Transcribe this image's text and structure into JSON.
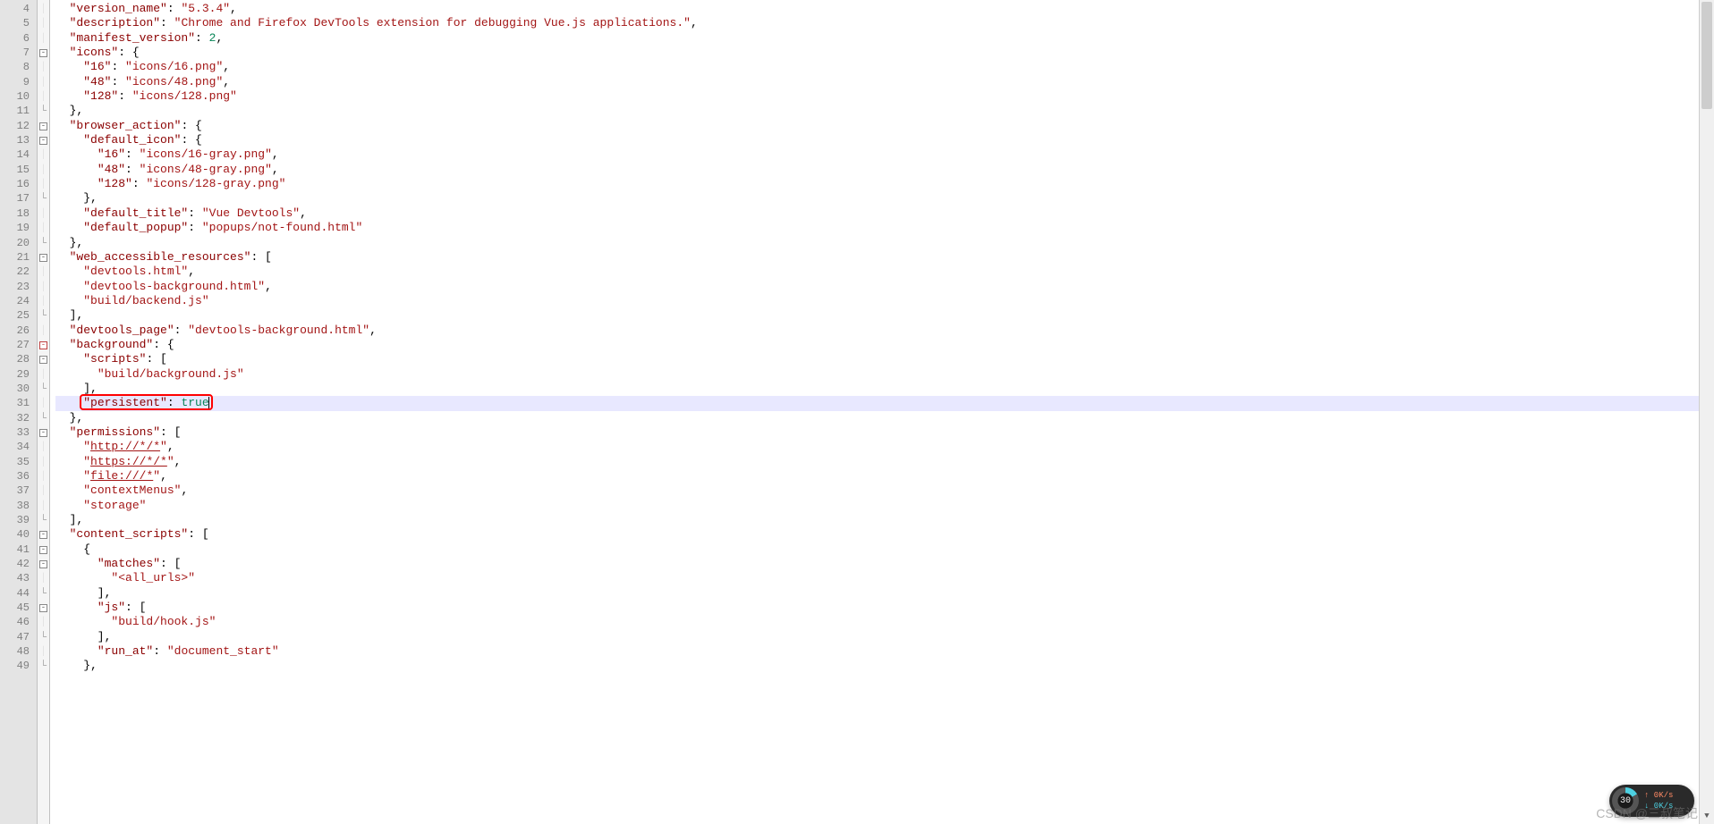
{
  "first_line": 4,
  "highlighted_line": 31,
  "lines": [
    {
      "t": [
        [
          "  ",
          "p"
        ],
        [
          "\"version_name\"",
          "key"
        ],
        [
          ": ",
          "p"
        ],
        [
          "\"5.3.4\"",
          "s"
        ],
        [
          ",",
          "p"
        ]
      ]
    },
    {
      "t": [
        [
          "  ",
          "p"
        ],
        [
          "\"description\"",
          "key"
        ],
        [
          ": ",
          "p"
        ],
        [
          "\"Chrome and Firefox DevTools extension for debugging Vue.js applications.\"",
          "s"
        ],
        [
          ",",
          "p"
        ]
      ]
    },
    {
      "t": [
        [
          "  ",
          "p"
        ],
        [
          "\"manifest_version\"",
          "key"
        ],
        [
          ": ",
          "p"
        ],
        [
          "2",
          "n"
        ],
        [
          ",",
          "p"
        ]
      ]
    },
    {
      "t": [
        [
          "  ",
          "p"
        ],
        [
          "\"icons\"",
          "key"
        ],
        [
          ": {",
          "p"
        ]
      ],
      "fold": "-"
    },
    {
      "t": [
        [
          "    ",
          "p"
        ],
        [
          "\"16\"",
          "key"
        ],
        [
          ": ",
          "p"
        ],
        [
          "\"icons/16.png\"",
          "s"
        ],
        [
          ",",
          "p"
        ]
      ]
    },
    {
      "t": [
        [
          "    ",
          "p"
        ],
        [
          "\"48\"",
          "key"
        ],
        [
          ": ",
          "p"
        ],
        [
          "\"icons/48.png\"",
          "s"
        ],
        [
          ",",
          "p"
        ]
      ]
    },
    {
      "t": [
        [
          "    ",
          "p"
        ],
        [
          "\"128\"",
          "key"
        ],
        [
          ": ",
          "p"
        ],
        [
          "\"icons/128.png\"",
          "s"
        ]
      ]
    },
    {
      "t": [
        [
          "  },",
          "p"
        ]
      ],
      "foldend": true
    },
    {
      "t": [
        [
          "  ",
          "p"
        ],
        [
          "\"browser_action\"",
          "key"
        ],
        [
          ": {",
          "p"
        ]
      ],
      "fold": "-"
    },
    {
      "t": [
        [
          "    ",
          "p"
        ],
        [
          "\"default_icon\"",
          "key"
        ],
        [
          ": {",
          "p"
        ]
      ],
      "fold": "-"
    },
    {
      "t": [
        [
          "      ",
          "p"
        ],
        [
          "\"16\"",
          "key"
        ],
        [
          ": ",
          "p"
        ],
        [
          "\"icons/16-gray.png\"",
          "s"
        ],
        [
          ",",
          "p"
        ]
      ]
    },
    {
      "t": [
        [
          "      ",
          "p"
        ],
        [
          "\"48\"",
          "key"
        ],
        [
          ": ",
          "p"
        ],
        [
          "\"icons/48-gray.png\"",
          "s"
        ],
        [
          ",",
          "p"
        ]
      ]
    },
    {
      "t": [
        [
          "      ",
          "p"
        ],
        [
          "\"128\"",
          "key"
        ],
        [
          ": ",
          "p"
        ],
        [
          "\"icons/128-gray.png\"",
          "s"
        ]
      ]
    },
    {
      "t": [
        [
          "    },",
          "p"
        ]
      ],
      "foldend": true
    },
    {
      "t": [
        [
          "    ",
          "p"
        ],
        [
          "\"default_title\"",
          "key"
        ],
        [
          ": ",
          "p"
        ],
        [
          "\"Vue Devtools\"",
          "s"
        ],
        [
          ",",
          "p"
        ]
      ]
    },
    {
      "t": [
        [
          "    ",
          "p"
        ],
        [
          "\"default_popup\"",
          "key"
        ],
        [
          ": ",
          "p"
        ],
        [
          "\"popups/not-found.html\"",
          "s"
        ]
      ]
    },
    {
      "t": [
        [
          "  },",
          "p"
        ]
      ],
      "foldend": true
    },
    {
      "t": [
        [
          "  ",
          "p"
        ],
        [
          "\"web_accessible_resources\"",
          "key"
        ],
        [
          ": [",
          "p"
        ]
      ],
      "fold": "-"
    },
    {
      "t": [
        [
          "    ",
          "p"
        ],
        [
          "\"devtools.html\"",
          "s"
        ],
        [
          ",",
          "p"
        ]
      ]
    },
    {
      "t": [
        [
          "    ",
          "p"
        ],
        [
          "\"devtools-background.html\"",
          "s"
        ],
        [
          ",",
          "p"
        ]
      ]
    },
    {
      "t": [
        [
          "    ",
          "p"
        ],
        [
          "\"build/backend.js\"",
          "s"
        ]
      ]
    },
    {
      "t": [
        [
          "  ],",
          "p"
        ]
      ],
      "foldend": true
    },
    {
      "t": [
        [
          "  ",
          "p"
        ],
        [
          "\"devtools_page\"",
          "key"
        ],
        [
          ": ",
          "p"
        ],
        [
          "\"devtools-background.html\"",
          "s"
        ],
        [
          ",",
          "p"
        ]
      ]
    },
    {
      "t": [
        [
          "  ",
          "p"
        ],
        [
          "\"background\"",
          "key"
        ],
        [
          ": {",
          "p"
        ]
      ],
      "fold": "-r"
    },
    {
      "t": [
        [
          "    ",
          "p"
        ],
        [
          "\"scripts\"",
          "key"
        ],
        [
          ": [",
          "p"
        ]
      ],
      "fold": "-"
    },
    {
      "t": [
        [
          "      ",
          "p"
        ],
        [
          "\"build/background.js\"",
          "s"
        ]
      ]
    },
    {
      "t": [
        [
          "    ],",
          "p"
        ]
      ],
      "foldend": true
    },
    {
      "t": [
        [
          "    ",
          "p"
        ],
        [
          "\"persistent\"",
          "key"
        ],
        [
          ": ",
          "p"
        ],
        [
          "true",
          "n"
        ]
      ],
      "hl": true,
      "caret": true
    },
    {
      "t": [
        [
          "  },",
          "p"
        ]
      ],
      "foldend": true
    },
    {
      "t": [
        [
          "  ",
          "p"
        ],
        [
          "\"permissions\"",
          "key"
        ],
        [
          ": [",
          "p"
        ]
      ],
      "fold": "-"
    },
    {
      "t": [
        [
          "    ",
          "p"
        ],
        [
          "\"",
          "s"
        ],
        [
          "http://*/*",
          "s u"
        ],
        [
          "\"",
          "s"
        ],
        [
          ",",
          "p"
        ]
      ]
    },
    {
      "t": [
        [
          "    ",
          "p"
        ],
        [
          "\"",
          "s"
        ],
        [
          "https://*/*",
          "s u"
        ],
        [
          "\"",
          "s"
        ],
        [
          ",",
          "p"
        ]
      ]
    },
    {
      "t": [
        [
          "    ",
          "p"
        ],
        [
          "\"",
          "s"
        ],
        [
          "file:///*",
          "s u"
        ],
        [
          "\"",
          "s"
        ],
        [
          ",",
          "p"
        ]
      ]
    },
    {
      "t": [
        [
          "    ",
          "p"
        ],
        [
          "\"contextMenus\"",
          "s"
        ],
        [
          ",",
          "p"
        ]
      ]
    },
    {
      "t": [
        [
          "    ",
          "p"
        ],
        [
          "\"storage\"",
          "s"
        ]
      ]
    },
    {
      "t": [
        [
          "  ],",
          "p"
        ]
      ],
      "foldend": true
    },
    {
      "t": [
        [
          "  ",
          "p"
        ],
        [
          "\"content_scripts\"",
          "key"
        ],
        [
          ": [",
          "p"
        ]
      ],
      "fold": "-"
    },
    {
      "t": [
        [
          "    {",
          "p"
        ]
      ],
      "fold": "-"
    },
    {
      "t": [
        [
          "      ",
          "p"
        ],
        [
          "\"matches\"",
          "key"
        ],
        [
          ": [",
          "p"
        ]
      ],
      "fold": "-"
    },
    {
      "t": [
        [
          "        ",
          "p"
        ],
        [
          "\"<all_urls>\"",
          "s"
        ]
      ]
    },
    {
      "t": [
        [
          "      ],",
          "p"
        ]
      ],
      "foldend": true
    },
    {
      "t": [
        [
          "      ",
          "p"
        ],
        [
          "\"js\"",
          "key"
        ],
        [
          ": [",
          "p"
        ]
      ],
      "fold": "-"
    },
    {
      "t": [
        [
          "        ",
          "p"
        ],
        [
          "\"build/hook.js\"",
          "s"
        ]
      ]
    },
    {
      "t": [
        [
          "      ],",
          "p"
        ]
      ],
      "foldend": true
    },
    {
      "t": [
        [
          "      ",
          "p"
        ],
        [
          "\"run_at\"",
          "key"
        ],
        [
          ": ",
          "p"
        ],
        [
          "\"document_start\"",
          "s"
        ]
      ]
    },
    {
      "t": [
        [
          "    },",
          "p"
        ]
      ],
      "foldend": true
    }
  ],
  "highlight_box": {
    "text": "\"persistent\": true"
  },
  "widget": {
    "gauge": "30",
    "up": "↑ 0K/s",
    "down": "↓ 0K/s"
  },
  "watermark": "CSDN @三叔笔记"
}
